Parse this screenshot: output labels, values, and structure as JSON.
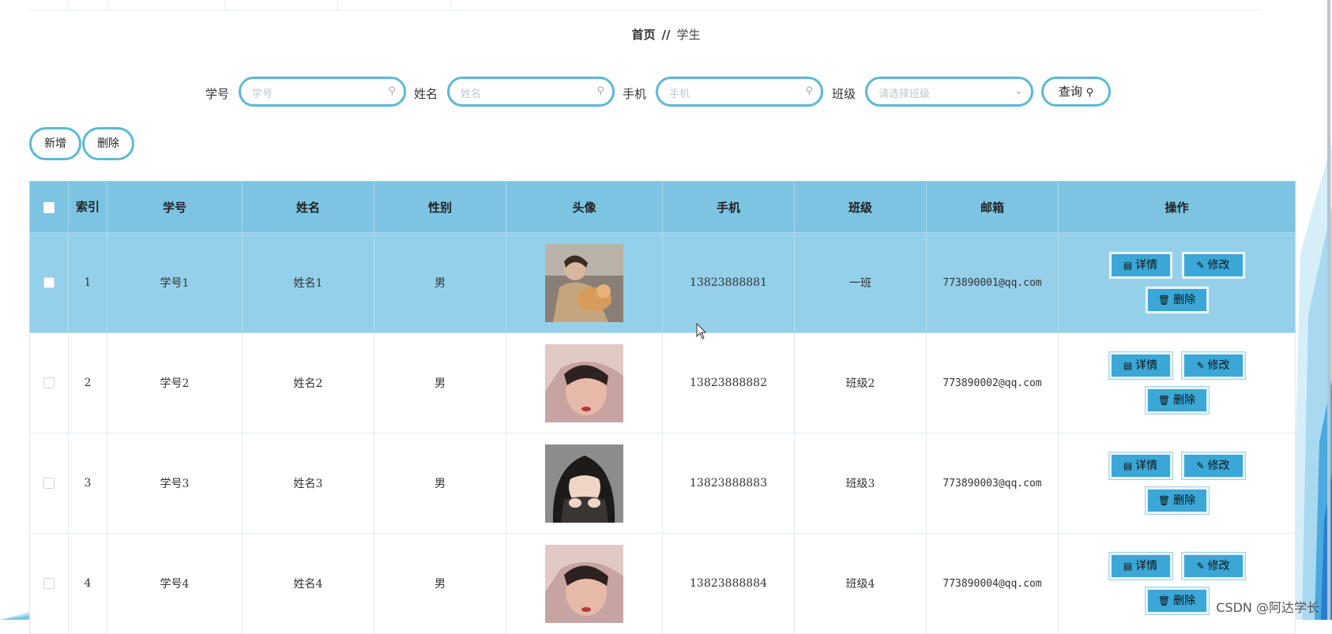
{
  "breadcrumb": {
    "home": "首页",
    "separator": "//",
    "current": "学生"
  },
  "search": {
    "fields": [
      {
        "label": "学号",
        "placeholder": "学号",
        "icon": "search-icon"
      },
      {
        "label": "姓名",
        "placeholder": "姓名",
        "icon": "search-icon"
      },
      {
        "label": "手机",
        "placeholder": "手机",
        "icon": "search-icon"
      },
      {
        "label": "班级",
        "placeholder": "请选择班级",
        "icon": "chevron-down-icon"
      }
    ],
    "query_label": "查询"
  },
  "actions": {
    "add_label": "新增",
    "delete_label": "删除"
  },
  "table": {
    "headers": [
      "索引",
      "学号",
      "姓名",
      "性别",
      "头像",
      "手机",
      "班级",
      "邮箱",
      "操作"
    ],
    "rows": [
      {
        "index": "1",
        "student_no": "学号1",
        "name": "姓名1",
        "gender": "男",
        "avatar": "photo-1",
        "phone": "13823888881",
        "class": "一班",
        "email": "773890001@qq.com",
        "highlighted": true
      },
      {
        "index": "2",
        "student_no": "学号2",
        "name": "姓名2",
        "gender": "男",
        "avatar": "photo-2",
        "phone": "13823888882",
        "class": "班级2",
        "email": "773890002@qq.com",
        "highlighted": false
      },
      {
        "index": "3",
        "student_no": "学号3",
        "name": "姓名3",
        "gender": "男",
        "avatar": "photo-3",
        "phone": "13823888883",
        "class": "班级3",
        "email": "773890003@qq.com",
        "highlighted": false
      },
      {
        "index": "4",
        "student_no": "学号4",
        "name": "姓名4",
        "gender": "男",
        "avatar": "photo-4",
        "phone": "13823888884",
        "class": "班级4",
        "email": "773890004@qq.com",
        "highlighted": false
      }
    ],
    "row_actions": {
      "detail": "详情",
      "edit": "修改",
      "delete": "删除"
    }
  },
  "watermark": "CSDN @阿达学长",
  "colors": {
    "accent": "#3aa7d6",
    "header_bg": "#7cc4e2",
    "highlight_row": "#95d0ea",
    "input_border": "#5cb9d8"
  }
}
